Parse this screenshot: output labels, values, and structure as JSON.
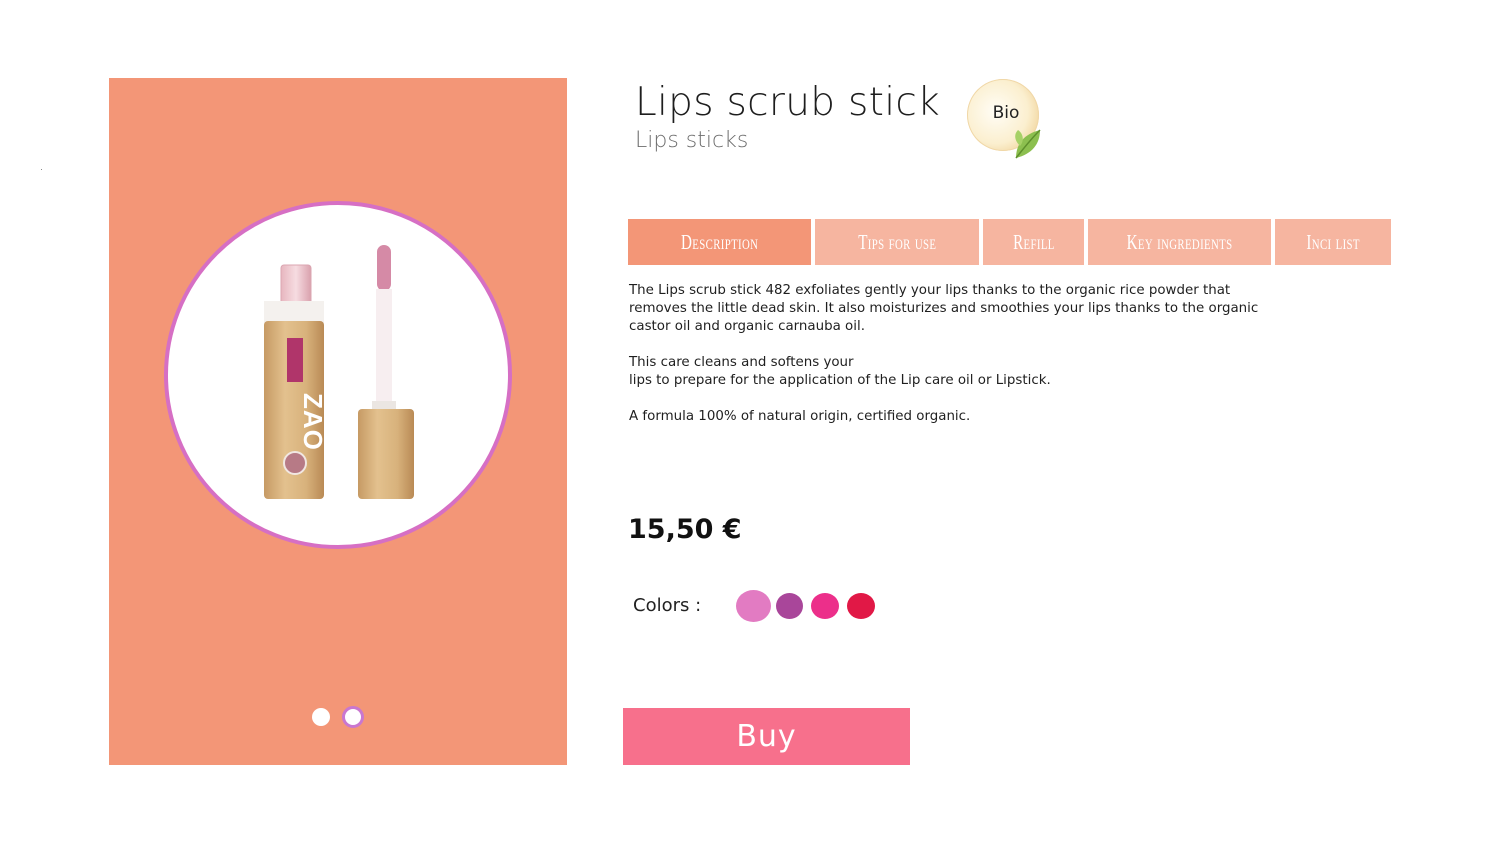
{
  "product": {
    "title": "Lips scrub stick",
    "category": "Lips sticks",
    "badge": "Bio",
    "brand_mark": "ZAO",
    "price": "15,50 €"
  },
  "gallery": {
    "slide_count": 2,
    "active_slide": 2
  },
  "tabs": [
    {
      "label": "Description",
      "active": true
    },
    {
      "label": "Tips for use",
      "active": false
    },
    {
      "label": "Refill",
      "active": false
    },
    {
      "label": "Key ingredients",
      "active": false
    },
    {
      "label": "Inci list",
      "active": false
    }
  ],
  "description": {
    "p1": "The Lips scrub stick 482 exfoliates gently your lips thanks to the organic rice powder that removes the little dead skin. It also moisturizes and smoothies your lips thanks to the organic castor oil and organic carnauba oil.",
    "p2_line1": "This care cleans and softens your",
    "p2_line2": "lips to prepare for the application of the Lip care oil or Lipstick.",
    "p3": "A formula 100% of natural origin, certified organic."
  },
  "colors": {
    "label": "Colors :",
    "swatches": [
      "#e27bc2",
      "#a9469a",
      "#ec2f8a",
      "#e11846"
    ]
  },
  "buy_label": "Buy",
  "theme": {
    "panel": "#f39677",
    "tab_inactive": "#f6b5a0",
    "buy": "#f7708c",
    "circle_border": "#d66fc4"
  }
}
